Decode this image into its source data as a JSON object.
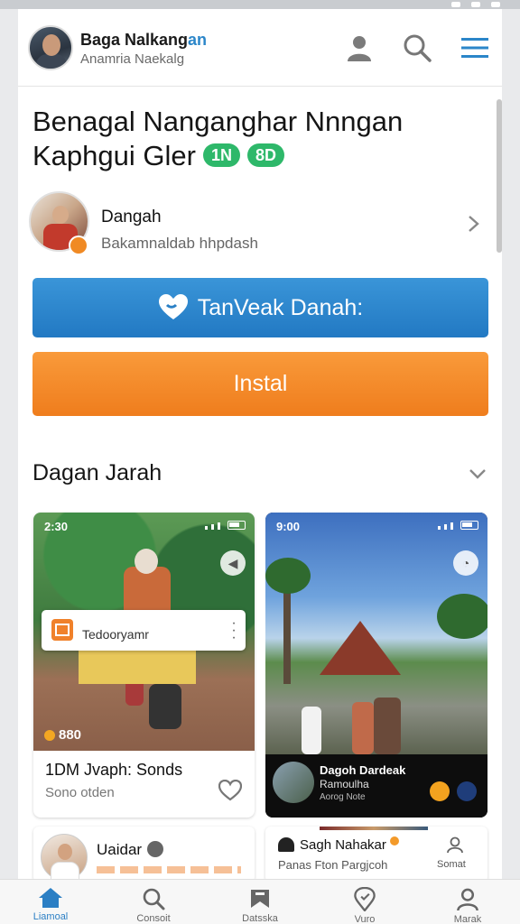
{
  "header": {
    "app_name_main": "Baga Nalkang",
    "app_name_highlight": "an",
    "subtitle": "Anamria Naekalg"
  },
  "title": {
    "line1": "Benagal Nanganghar Nnngan",
    "line2": "Kaphgui Gler",
    "badge1": "1N",
    "badge2": "8D"
  },
  "developer": {
    "name": "Dangah",
    "subtitle": "Bakamnaldab hhpdash"
  },
  "buttons": {
    "primary": "TanVeak Danah:",
    "install": "Instal"
  },
  "section": {
    "title": "Dagan Jarah"
  },
  "screenshots": [
    {
      "time": "2:30",
      "overlay_title_small": "",
      "overlay_label": "Tedooryamr",
      "rating": "880",
      "title": "1DM Jvaph: Sonds",
      "subtitle": "Sono otden"
    },
    {
      "time": "9:00",
      "info_title": "Dagoh Dardeak",
      "info_sub1": "Ramoulha",
      "info_sub2": "Aorog   Note"
    }
  ],
  "mini_cards": [
    {
      "name": "Uaidar"
    },
    {
      "name": "Sagh Nahakar",
      "subtitle": "Panas Fton Pargjcoh",
      "side_label": "Somat"
    }
  ],
  "bottom_nav": [
    {
      "label": "Liamoal",
      "icon": "home-icon",
      "active": true
    },
    {
      "label": "Consoit",
      "icon": "search-icon",
      "active": false
    },
    {
      "label": "Datsska",
      "icon": "tag-icon",
      "active": false
    },
    {
      "label": "Vuro",
      "icon": "location-icon",
      "active": false
    },
    {
      "label": "Marak",
      "icon": "user-icon",
      "active": false
    }
  ],
  "colors": {
    "primary_blue": "#2b86c9",
    "install_orange": "#f28a2a",
    "badge_green": "#2eb86a"
  }
}
